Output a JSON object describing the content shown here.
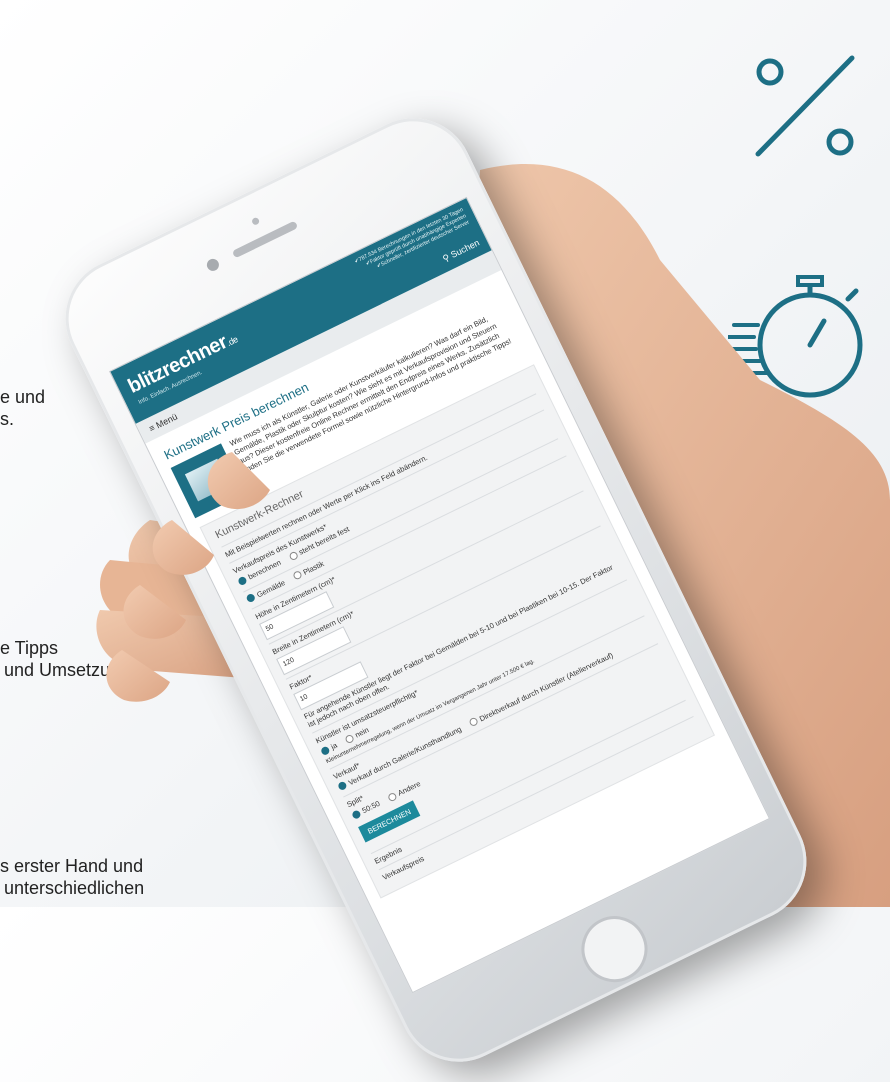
{
  "side_texts": [
    "e und",
    "s.",
    "e Tipps",
    "und Umsetzung",
    "s erster Hand und",
    "unterschiedlichen"
  ],
  "icons": {
    "percent": "percent-icon",
    "stopwatch": "stopwatch-icon",
    "accent_color": "#1d6f85"
  },
  "site": {
    "logo": "blitzrechner",
    "logo_tld": ".de",
    "tagline": "Info. Einfach. Ausrechnen.",
    "trust_items": [
      "787.534 Berechnungen in den letzten 30 Tagen",
      "Faktor geprüft durch unabhängige Experten",
      "Schneller, zertifizierter deutscher Server"
    ],
    "search_label": "Suchen",
    "menu_label": "Menü"
  },
  "page": {
    "title": "Kunstwerk Preis berechnen",
    "intro": "Wie muss ich als Künstler, Galerie oder Kunstverkäufer kalkulieren? Was darf ein Bild, Gemälde, Plastik oder Skulptur kosten? Wie sieht es mit Verkaufsprovision und Steuern aus? Dieser kostenfreie Online Rechner ermittelt den Endpreis eines Werks. Zusätzlich finden Sie die verwendete Formel sowie nützliche Hintergrund-Infos und praktische Tipps!",
    "calculator": {
      "title": "Kunstwerk-Rechner",
      "hint": "Mit Beispielwerten rechnen oder Werte per Klick ins Feld abändern.",
      "price_label": "Verkaufspreis des Kunstwerks*",
      "price_options": [
        "berechnen",
        "steht bereits fest"
      ],
      "type_options": [
        "Gemälde",
        "Plastik"
      ],
      "height_label": "Höhe in Zentimetern (cm)*",
      "height_value": "50",
      "width_label": "Breite in Zentimetern (cm)*",
      "width_value": "120",
      "factor_label": "Faktor*",
      "factor_value": "10",
      "factor_hint": "Für angehende Künstler liegt der Faktor bei Gemälden bei 5-10 und bei Plastiken bei 10-15. Der Faktor ist jedoch nach oben offen.",
      "vat_label": "Künstler ist umsatzsteuerpflichtig*",
      "vat_options": [
        "ja",
        "nein"
      ],
      "vat_hint": "Kleinunternehmerregelung, wenn der Umsatz im Vergangenen Jahr unter 17.500 € lag.",
      "sale_label": "Verkauf*",
      "sale_options": [
        "Verkauf durch Galerie/Kunsthandlung",
        "Direktverkauf durch Künstler (Atelierverkauf)"
      ],
      "split_label": "Split*",
      "split_options": [
        "50:50",
        "Andere"
      ],
      "button": "BERECHNEN",
      "result_label": "Ergebnis",
      "result_row": "Verkaufspreis"
    }
  }
}
